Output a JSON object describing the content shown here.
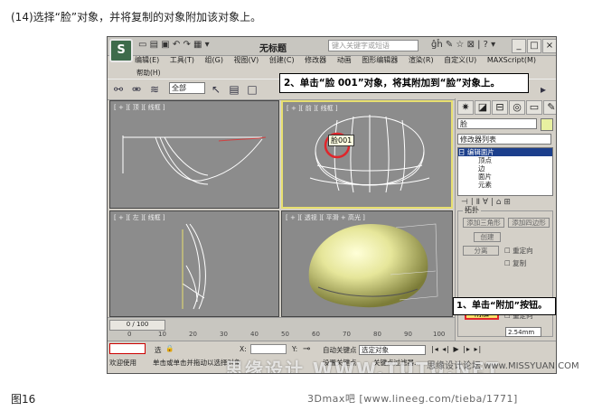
{
  "caption": "(14)选择“脸”对象，并将复制的对象附加该对象上。",
  "figure_label": "图16",
  "footer_source": "3Dmax吧 [www.lineeg.com/tieba/1771]",
  "forum_mark": "思缘设计论坛 www.MISSYUAN.COM",
  "watermark": "思缘设计 WWW.TUTU.NET",
  "app": {
    "title": "无标题",
    "search_placeholder": "键入关键字或短语",
    "logo": "S",
    "menu": [
      "编辑(E)",
      "工具(T)",
      "组(G)",
      "视图(V)",
      "创建(C)",
      "修改器",
      "动画",
      "图形编辑器",
      "渲染(R)",
      "自定义(U)",
      "MAXScript(M)"
    ],
    "menu_help": "帮助(H)",
    "selection_filter": "全部",
    "window_buttons": [
      "_",
      "□",
      "×"
    ]
  },
  "callouts": {
    "step2": "2、单击“脸 001”对象，将其附加到“脸”对象上。",
    "step1": "1、单击“附加”按钮。"
  },
  "viewports": {
    "top": "[ + ][ 顶 ][ 线框 ]",
    "front": "[ + ][ 前 ][ 线框 ]",
    "left": "[ + ][ 左 ][ 线框 ]",
    "perspective": "[ + ][ 透视 ][ 平滑 + 高光 ]",
    "tooltip": "脸001"
  },
  "panel": {
    "object_name": "脸",
    "modifier_list": "修改器列表",
    "stack": [
      "日 编辑面片",
      "顶点",
      "边",
      "面片",
      "元素"
    ],
    "group_title": "拓扑",
    "buttons": [
      "添加三角形",
      "添加四边形",
      "创建",
      "分离"
    ],
    "checks": [
      "重定向",
      "复制",
      "重定向",
      "重定向"
    ],
    "attach": "附加"
  },
  "timeline": {
    "slider": "0 / 100",
    "ticks": [
      "0",
      "10",
      "20",
      "30",
      "40",
      "50",
      "60",
      "70",
      "80",
      "90",
      "100"
    ]
  },
  "status": {
    "selected": "选",
    "x_label": "X:",
    "y_label": "Y:",
    "auto_key": "自动关键点",
    "set_key": "设置关键点",
    "selected_object": "选定对象",
    "key_filters": "关键点过滤器...",
    "welcome": "欢迎使用",
    "prompt": "单击或单击并拖动以选择对象",
    "spinner": "2.54mm"
  }
}
